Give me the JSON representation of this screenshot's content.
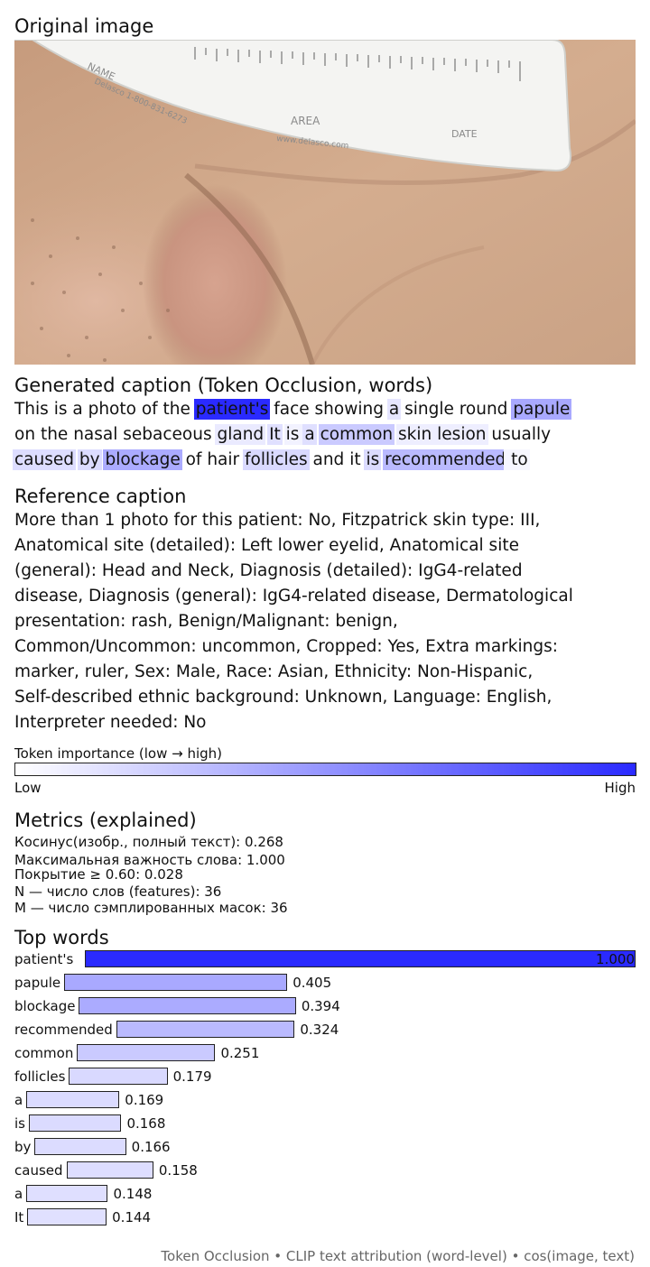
{
  "headings": {
    "original": "Original image",
    "generated": "Generated caption (Token Occlusion, words)",
    "reference": "Reference caption",
    "metrics": "Metrics (explained)",
    "top_words": "Top words"
  },
  "photo": {
    "ruler_text": [
      "NAME",
      "Delasco 1-800-831-6273",
      "AREA",
      "www.delasco.com",
      "DATE"
    ]
  },
  "caption_lines": [
    [
      {
        "t": "This ",
        "i": 0
      },
      {
        "t": "is ",
        "i": 0
      },
      {
        "t": "a ",
        "i": 0
      },
      {
        "t": "photo ",
        "i": 0
      },
      {
        "t": "of ",
        "i": 0
      },
      {
        "t": "the ",
        "i": 0
      },
      {
        "t": "patient's",
        "i": 1.0
      },
      {
        "t": " face ",
        "i": 0
      },
      {
        "t": "showing ",
        "i": 0
      },
      {
        "t": "a",
        "i": 0.12
      },
      {
        "t": " single ",
        "i": 0
      },
      {
        "t": "round ",
        "i": 0
      },
      {
        "t": "papule",
        "i": 0.405
      }
    ],
    [
      {
        "t": "on ",
        "i": 0
      },
      {
        "t": "the ",
        "i": 0
      },
      {
        "t": "nasal ",
        "i": 0
      },
      {
        "t": "sebaceous ",
        "i": 0
      },
      {
        "t": "gland",
        "i": 0.1
      },
      {
        "t": " ",
        "i": 0
      },
      {
        "t": "It",
        "i": 0.144
      },
      {
        "t": " ",
        "i": 0
      },
      {
        "t": "is ",
        "i": 0.06
      },
      {
        "t": "a",
        "i": 0.148
      },
      {
        "t": " ",
        "i": 0
      },
      {
        "t": "common",
        "i": 0.251
      },
      {
        "t": " ",
        "i": 0
      },
      {
        "t": "skin ",
        "i": 0.08
      },
      {
        "t": "lesion",
        "i": 0.08
      },
      {
        "t": " ",
        "i": 0
      },
      {
        "t": "usually",
        "i": 0
      }
    ],
    [
      {
        "t": "caused",
        "i": 0.158
      },
      {
        "t": " ",
        "i": 0
      },
      {
        "t": "by",
        "i": 0.166
      },
      {
        "t": " ",
        "i": 0
      },
      {
        "t": "blockage",
        "i": 0.394
      },
      {
        "t": " of ",
        "i": 0
      },
      {
        "t": "hair ",
        "i": 0
      },
      {
        "t": "follicles",
        "i": 0.179
      },
      {
        "t": " ",
        "i": 0
      },
      {
        "t": "and ",
        "i": 0
      },
      {
        "t": "it ",
        "i": 0
      },
      {
        "t": "is",
        "i": 0.168
      },
      {
        "t": " ",
        "i": 0
      },
      {
        "t": "recommended",
        "i": 0.324
      },
      {
        "t": " to",
        "i": 0.04
      }
    ]
  ],
  "reference_lines": [
    "More than 1 photo for this patient: No, Fitzpatrick skin type: III,",
    "Anatomical site (detailed): Left lower eyelid, Anatomical site",
    "(general): Head and Neck, Diagnosis (detailed): IgG4-related",
    "disease, Diagnosis (general): IgG4-related disease, Dermatological",
    "presentation: rash, Benign/Malignant: benign,",
    "Common/Uncommon: uncommon, Cropped: Yes, Extra markings:",
    "marker, ruler, Sex: Male, Race: Asian, Ethnicity: Non-Hispanic,",
    "Self-described ethnic background: Unknown, Language: English,",
    "Interpreter needed: No"
  ],
  "colorbar": {
    "title": "Token importance (low → high)",
    "low": "Low",
    "high": "High",
    "low_color": "#ffffff",
    "high_color": "#2a2aff"
  },
  "metrics": [
    "Косинус(изобр., полный текст): 0.268",
    "Максимальная важность слова: 1.000",
    "Покрытие ≥ 0.60: 0.028",
    "N — число слов (features): 36",
    "M — число сэмплированных масок: 36"
  ],
  "chart_data": {
    "type": "bar",
    "orientation": "horizontal",
    "title": "Top words",
    "categories": [
      "patient's",
      "papule",
      "blockage",
      "recommended",
      "common",
      "follicles",
      "a",
      "is",
      "by",
      "caused",
      "a",
      "It"
    ],
    "values": [
      1.0,
      0.405,
      0.394,
      0.324,
      0.251,
      0.179,
      0.169,
      0.168,
      0.166,
      0.158,
      0.148,
      0.144
    ],
    "value_labels": [
      "1.000",
      "0.405",
      "0.394",
      "0.324",
      "0.251",
      "0.179",
      "0.169",
      "0.168",
      "0.166",
      "0.158",
      "0.148",
      "0.144"
    ],
    "xlim": [
      0,
      1
    ],
    "grid": false,
    "colormap": [
      "#ffffff",
      "#2a2aff"
    ]
  },
  "footer": "Token Occlusion • CLIP text attribution (word-level) • cos(image, text)"
}
